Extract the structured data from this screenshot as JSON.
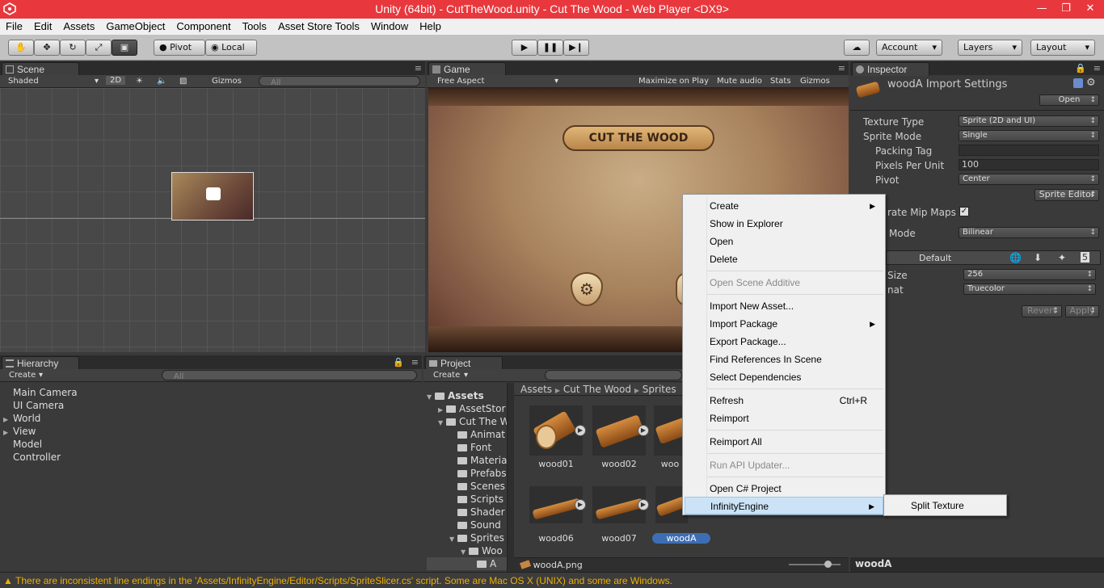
{
  "window": {
    "title": "Unity (64bit) - CutTheWood.unity - Cut The Wood - Web Player <DX9>",
    "controls": [
      "—",
      "❐",
      "✕"
    ]
  },
  "menu": [
    "File",
    "Edit",
    "Assets",
    "GameObject",
    "Component",
    "Tools",
    "Asset Store Tools",
    "Window",
    "Help"
  ],
  "toolbar": {
    "pivot": "Pivot",
    "local": "Local",
    "account": "Account",
    "layers": "Layers",
    "layout": "Layout"
  },
  "scene": {
    "tab": "Scene",
    "shading": "Shaded",
    "mode_2d": "2D",
    "gizmos": "Gizmos",
    "search_placeholder": "All"
  },
  "game": {
    "tab": "Game",
    "aspect": "Free Aspect",
    "maximize": "Maximize on Play",
    "mute": "Mute audio",
    "stats": "Stats",
    "gizmos": "Gizmos",
    "banner": "CUT THE WOOD"
  },
  "inspector": {
    "tab": "Inspector",
    "title": "woodA Import Settings",
    "open": "Open",
    "rows": [
      {
        "label": "Texture Type",
        "value": "Sprite (2D and UI)"
      },
      {
        "label": "Sprite Mode",
        "value": "Single"
      },
      {
        "label": "Packing Tag",
        "value": ""
      },
      {
        "label": "Pixels Per Unit",
        "value": "100"
      },
      {
        "label": "Pivot",
        "value": "Center"
      }
    ],
    "sprite_editor": "Sprite Editor",
    "mipmaps_label": "rate Mip Maps",
    "filter_label": "Mode",
    "filter_value": "Bilinear",
    "platform_default": "Default",
    "max_size_label": "Size",
    "max_size_value": "256",
    "format_label": "nat",
    "format_value": "Truecolor",
    "revert": "Revert",
    "apply": "Apply",
    "footer_name": "woodA"
  },
  "hierarchy": {
    "tab": "Hierarchy",
    "create": "Create",
    "search_placeholder": "All",
    "items": [
      {
        "name": "Main Camera",
        "expandable": false
      },
      {
        "name": "UI Camera",
        "expandable": false
      },
      {
        "name": "World",
        "expandable": true
      },
      {
        "name": "View",
        "expandable": true
      },
      {
        "name": "Model",
        "expandable": false
      },
      {
        "name": "Controller",
        "expandable": false
      }
    ]
  },
  "project": {
    "tab": "Project",
    "create": "Create",
    "tree": [
      {
        "name": "Assets",
        "depth": 0,
        "arrow": "▼"
      },
      {
        "name": "AssetStor",
        "depth": 1,
        "arrow": "▶"
      },
      {
        "name": "Cut The W",
        "depth": 1,
        "arrow": "▼"
      },
      {
        "name": "Animat",
        "depth": 2,
        "arrow": ""
      },
      {
        "name": "Font",
        "depth": 2,
        "arrow": ""
      },
      {
        "name": "Materia",
        "depth": 2,
        "arrow": ""
      },
      {
        "name": "Prefabs",
        "depth": 2,
        "arrow": ""
      },
      {
        "name": "Scenes",
        "depth": 2,
        "arrow": ""
      },
      {
        "name": "Scripts",
        "depth": 2,
        "arrow": ""
      },
      {
        "name": "Shader",
        "depth": 2,
        "arrow": ""
      },
      {
        "name": "Sound",
        "depth": 2,
        "arrow": ""
      },
      {
        "name": "Sprites",
        "depth": 2,
        "arrow": "▼"
      },
      {
        "name": "Woo",
        "depth": 3,
        "arrow": "▼"
      },
      {
        "name": "A",
        "depth": 4,
        "arrow": ""
      }
    ],
    "breadcrumb": [
      "Assets",
      "Cut The Wood",
      "Sprites"
    ],
    "assets": [
      "wood01",
      "wood02",
      "woo",
      "wood06",
      "wood07",
      "woodA"
    ],
    "selected_file": "woodA.png"
  },
  "context_menu": {
    "items": [
      {
        "label": "Create",
        "submenu": true
      },
      {
        "label": "Show in Explorer"
      },
      {
        "label": "Open"
      },
      {
        "label": "Delete"
      },
      {
        "label": "Open Scene Additive",
        "disabled": true
      },
      {
        "label": "Import New Asset..."
      },
      {
        "label": "Import Package",
        "submenu": true
      },
      {
        "label": "Export Package..."
      },
      {
        "label": "Find References In Scene"
      },
      {
        "label": "Select Dependencies"
      },
      {
        "label": "Refresh",
        "shortcut": "Ctrl+R"
      },
      {
        "label": "Reimport"
      },
      {
        "label": "Reimport All"
      },
      {
        "label": "Run API Updater...",
        "disabled": true
      },
      {
        "label": "Open C# Project"
      },
      {
        "label": "InfinityEngine",
        "submenu": true,
        "highlighted": true
      }
    ],
    "submenu_item": "Split Texture"
  },
  "status": {
    "message": "There are inconsistent line endings in the 'Assets/InfinityEngine/Editor/Scripts/SpriteSlicer.cs' script. Some are Mac OS X (UNIX) and some are Windows."
  },
  "colors": {
    "titlebar": "#e8383d",
    "selection": "#3d6eb4",
    "warning": "#f0b000"
  }
}
